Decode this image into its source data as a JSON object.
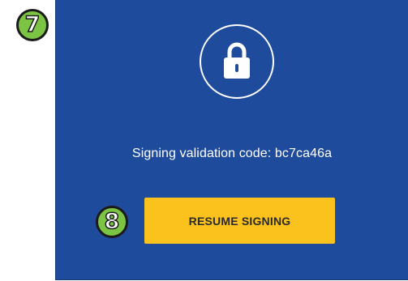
{
  "steps": {
    "badge_top": "7",
    "badge_button": "8"
  },
  "lock": {
    "icon": "lock-icon"
  },
  "validation": {
    "text": "Signing validation code: bc7ca46a"
  },
  "actions": {
    "resume_label": "RESUME SIGNING"
  },
  "colors": {
    "panel_background": "#1f4b9c",
    "button_background": "#fbc21d",
    "step_badge": "#7cc443"
  }
}
